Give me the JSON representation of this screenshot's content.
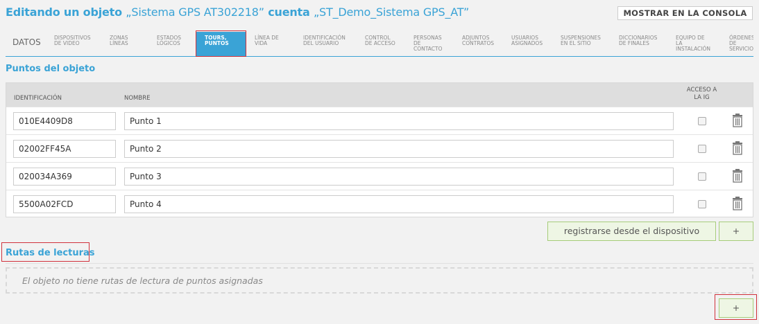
{
  "header": {
    "prefix": "Editando un objeto",
    "object_name": "„Sistema GPS AT302218”",
    "account_label": "cuenta",
    "account_name": "„ST_Demo_Sistema GPS_AT”",
    "console_button": "MOSTRAR EN LA CONSOLA"
  },
  "tabs": [
    {
      "label": "DATOS",
      "lines": [
        "DATOS"
      ]
    },
    {
      "label": "DISPOSITIVOS DE VIDEO",
      "lines": [
        "DISPOSITIVOS",
        "DE VIDEO"
      ]
    },
    {
      "label": "ZONAS LÍNEAS",
      "lines": [
        "ZONAS",
        "LÍNEAS"
      ]
    },
    {
      "label": "ESTADOS LÓGICOS",
      "lines": [
        "ESTADOS",
        "LÓGICOS"
      ]
    },
    {
      "label": "TOURS, PUNTOS",
      "lines": [
        "TOURS,",
        "PUNTOS"
      ],
      "active": true
    },
    {
      "label": "LÍNEA DE VIDA",
      "lines": [
        "LÍNEA DE",
        "VIDA"
      ]
    },
    {
      "label": "IDENTIFICACIÓN DEL USUARIO",
      "lines": [
        "IDENTIFICACIÓN",
        "DEL USUARIO"
      ]
    },
    {
      "label": "CONTROL DE ACCESO",
      "lines": [
        "CONTROL",
        "DE ACCESO"
      ]
    },
    {
      "label": "PERSONAS DE CONTACTO",
      "lines": [
        "PERSONAS",
        "DE",
        "CONTACTO"
      ]
    },
    {
      "label": "ADJUNTOS CONTRATOS",
      "lines": [
        "ADJUNTOS",
        "CONTRATOS"
      ]
    },
    {
      "label": "USUARIOS ASIGNADOS",
      "lines": [
        "USUARIOS",
        "ASIGNADOS"
      ]
    },
    {
      "label": "SUSPENSIONES EN EL SITIO",
      "lines": [
        "SUSPENSIONES",
        "EN EL SITIO"
      ]
    },
    {
      "label": "DICCIONARIOS DE FINALES",
      "lines": [
        "DICCIONARIOS",
        "DE FINALES"
      ]
    },
    {
      "label": "EQUIPO DE LA INSTALACIÓN",
      "lines": [
        "EQUIPO DE",
        "LA",
        "INSTALACIÓN"
      ]
    },
    {
      "label": "ÓRDENES DE SERVICIO",
      "lines": [
        "ÓRDENES",
        "DE",
        "SERVICIO"
      ]
    }
  ],
  "points_section": {
    "title": "Puntos del objeto",
    "columns": {
      "id": "IDENTIFICACIÓN",
      "name": "NOMBRE",
      "access": [
        "ACCESO A",
        "LA IG"
      ]
    },
    "rows": [
      {
        "id": "010E4409D8",
        "name": "Punto 1",
        "access": false
      },
      {
        "id": "02002FF45A",
        "name": "Punto 2",
        "access": false
      },
      {
        "id": "020034A369",
        "name": "Punto 3",
        "access": false
      },
      {
        "id": "5500A02FCD",
        "name": "Punto 4",
        "access": false
      }
    ],
    "register_button": "registrarse desde el dispositivo",
    "add_button": "+"
  },
  "routes_section": {
    "title": "Rutas de lecturas",
    "empty_text": "El objeto no tiene rutas de lectura de puntos asignadas",
    "add_button": "+"
  },
  "colors": {
    "accent": "#3aa3d6",
    "highlight": "#d0303a",
    "button_green_border": "#a6cc7a"
  }
}
